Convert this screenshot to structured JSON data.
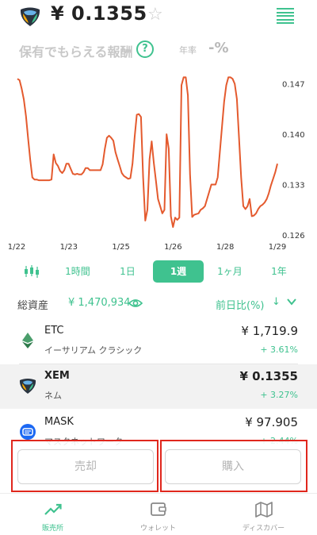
{
  "header": {
    "price": "¥ 0.1355",
    "favorite_icon": "star-icon",
    "menu_icon": "list-icon"
  },
  "reward": {
    "label": "保有でもらえる報酬",
    "help_icon": "question-icon",
    "rate_label": "年率",
    "rate_value": "-%"
  },
  "chart_data": {
    "type": "line",
    "xlabel": "",
    "ylabel": "",
    "x_ticks": [
      "1/22",
      "1/23",
      "1/25",
      "1/26",
      "1/28",
      "1/29"
    ],
    "y_ticks": [
      "0.147",
      "0.140",
      "0.133",
      "0.126"
    ],
    "ylim": [
      0.126,
      0.1485
    ],
    "grid": false,
    "color": "#e45a2e",
    "series": [
      {
        "values": [
          0.1477,
          0.1475,
          0.1463,
          0.1448,
          0.1425,
          0.1395,
          0.1365,
          0.134,
          0.1337,
          0.1337,
          0.1336,
          0.1336,
          0.1336,
          0.1336,
          0.1336,
          0.1336,
          0.1337,
          0.1372,
          0.136,
          0.1356,
          0.1349,
          0.1346,
          0.135,
          0.1359,
          0.1359,
          0.1352,
          0.1345,
          0.1344,
          0.1345,
          0.1344,
          0.1344,
          0.1347,
          0.1353,
          0.1353,
          0.135,
          0.135,
          0.135,
          0.135,
          0.135,
          0.135,
          0.1358,
          0.1379,
          0.1395,
          0.1398,
          0.1395,
          0.1391,
          0.1375,
          0.1365,
          0.1356,
          0.1346,
          0.1342,
          0.134,
          0.1338,
          0.1339,
          0.1359,
          0.1396,
          0.1427,
          0.1428,
          0.1424,
          0.134,
          0.128,
          0.1295,
          0.1365,
          0.139,
          0.136,
          0.1335,
          0.131,
          0.13,
          0.129,
          0.1295,
          0.14,
          0.138,
          0.1286,
          0.1271,
          0.1284,
          0.1281,
          0.1284,
          0.1468,
          0.1479,
          0.1479,
          0.1454,
          0.1344,
          0.1285,
          0.1288,
          0.1289,
          0.129,
          0.1295,
          0.1297,
          0.13,
          0.131,
          0.132,
          0.133,
          0.133,
          0.133,
          0.134,
          0.1375,
          0.141,
          0.1445,
          0.1468,
          0.1479,
          0.1479,
          0.1477,
          0.147,
          0.1449,
          0.1395,
          0.134,
          0.13,
          0.1296,
          0.13,
          0.131,
          0.1286,
          0.1287,
          0.129,
          0.1296,
          0.13,
          0.1302,
          0.1305,
          0.131,
          0.1318,
          0.1329,
          0.1338,
          0.1347,
          0.1359
        ]
      }
    ]
  },
  "range_tabs": {
    "chart_type_icon": "candlestick-icon",
    "items": [
      "1時間",
      "1日",
      "1週",
      "1ヶ月",
      "1年"
    ],
    "active_index": 2
  },
  "assets": {
    "label": "総資産",
    "value": "¥ 1,470,934",
    "eye_icon": "eye-icon",
    "change_label": "前日比(%)",
    "sort_arrow": "↓",
    "chevron": "⌄"
  },
  "coins": [
    {
      "icon": "etc-icon",
      "symbol": "ETC",
      "name": "イーサリアム クラシック",
      "price": "¥ 1,719.9",
      "change": "+ 3.61%"
    },
    {
      "icon": "xem-icon",
      "symbol": "XEM",
      "name": "ネム",
      "price": "¥ 0.1355",
      "change": "+ 3.27%"
    },
    {
      "icon": "mask-icon",
      "symbol": "MASK",
      "name": "マスクネットワーク",
      "price": "¥ 97.905",
      "change": "+ 2.44%"
    }
  ],
  "actions": {
    "sell_label": "売却",
    "buy_label": "購入"
  },
  "nav": [
    {
      "icon": "chart-trend-icon",
      "label": "販売所"
    },
    {
      "icon": "wallet-icon",
      "label": "ウォレット"
    },
    {
      "icon": "map-icon",
      "label": "ディスカバー"
    }
  ],
  "colors": {
    "accent": "#3fc28f",
    "chart_line": "#e45a2e",
    "highlight": "#e0271d"
  }
}
